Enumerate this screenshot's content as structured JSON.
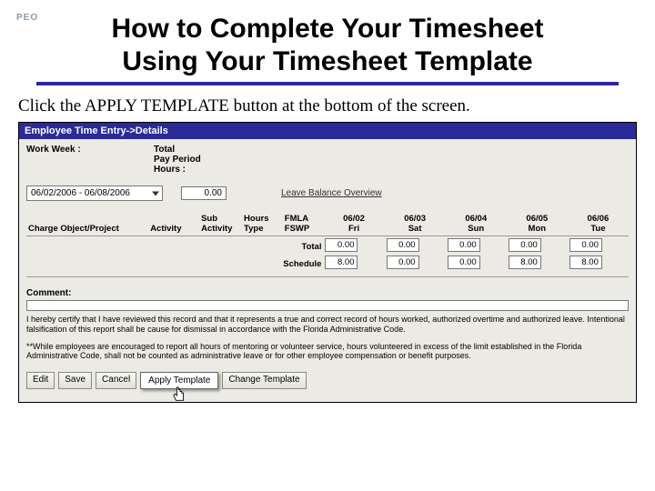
{
  "logo": "PEO",
  "title_l1": "How to Complete Your Timesheet",
  "title_l2": "Using Your Timesheet Template",
  "instruction": "Click the APPLY TEMPLATE button at the bottom of the screen.",
  "app": {
    "header": "Employee Time Entry->Details",
    "workweek_label": "Work Week :",
    "totals_label_l1": "Total",
    "totals_label_l2": "Pay Period",
    "totals_label_l3": "Hours :",
    "workweek_value": "06/02/2006 - 06/08/2006",
    "total_hours": "0.00",
    "leave_link": "Leave Balance Overview",
    "cols": {
      "charge": "Charge Object/Project",
      "activity": "Activity",
      "sub_l1": "Sub",
      "sub_l2": "Activity",
      "hours_l1": "Hours",
      "hours_l2": "Type",
      "fmla_l1": "FMLA",
      "fmla_l2": "FSWP",
      "d0_l1": "06/02",
      "d0_l2": "Fri",
      "d1_l1": "06/03",
      "d1_l2": "Sat",
      "d2_l1": "06/04",
      "d2_l2": "Sun",
      "d3_l1": "06/05",
      "d3_l2": "Mon",
      "d4_l1": "06/06",
      "d4_l2": "Tue"
    },
    "total_row_label": "Total",
    "schedule_row_label": "Schedule",
    "totals": [
      "0.00",
      "0.00",
      "0.00",
      "0.00",
      "0.00"
    ],
    "schedule": [
      "8.00",
      "0.00",
      "0.00",
      "8.00",
      "8.00"
    ],
    "comment_label": "Comment:",
    "legal1": "I hereby certify that I have reviewed this record and that it represents a true and correct record of hours worked, authorized overtime and authorized leave. Intentional falsification of this report shall be cause for dismissal in accordance with the Florida Administrative Code.",
    "legal2": "**While employees are encouraged to report all hours of mentoring or volunteer service, hours volunteered in excess of the limit established in the Florida Administrative Code, shall not be counted as administrative leave or for other employee compensation or benefit purposes."
  },
  "buttons": {
    "edit": "Edit",
    "save": "Save",
    "cancel": "Cancel",
    "apply": "Apply Template",
    "change": "Change Template"
  }
}
